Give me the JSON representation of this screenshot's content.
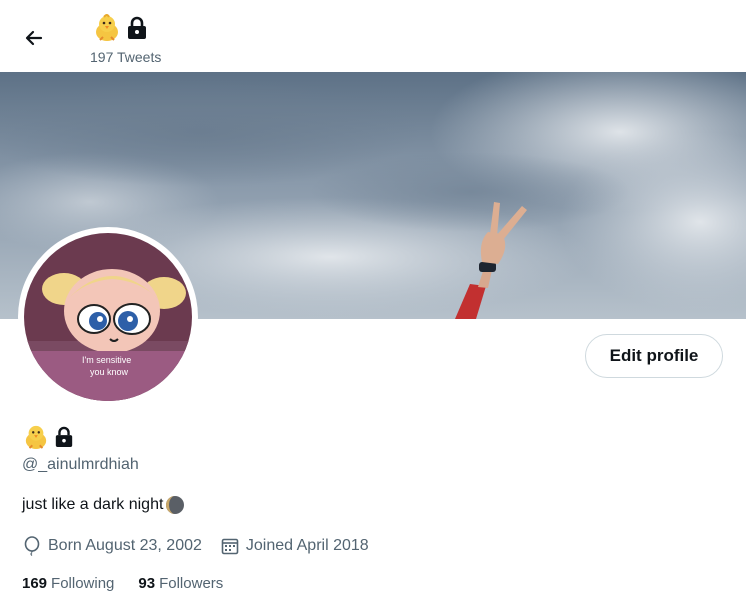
{
  "header": {
    "tweets_count": "197 Tweets",
    "name_emojis": [
      "chick-emoji",
      "lock-icon"
    ]
  },
  "profile": {
    "avatar_caption_line1": "I'm sensitive",
    "avatar_caption_line2": "you know",
    "handle": "@_ainulmrdhiah",
    "bio": "just like a dark night",
    "birthday": "Born August 23, 2002",
    "joined": "Joined April 2018"
  },
  "buttons": {
    "edit_profile": "Edit profile"
  },
  "stats": {
    "following_count": "169",
    "following_label": "Following",
    "followers_count": "93",
    "followers_label": "Followers"
  },
  "icons": [
    "back-arrow-icon",
    "chick-emoji",
    "lock-icon",
    "balloon-icon",
    "calendar-icon",
    "moon-emoji"
  ]
}
